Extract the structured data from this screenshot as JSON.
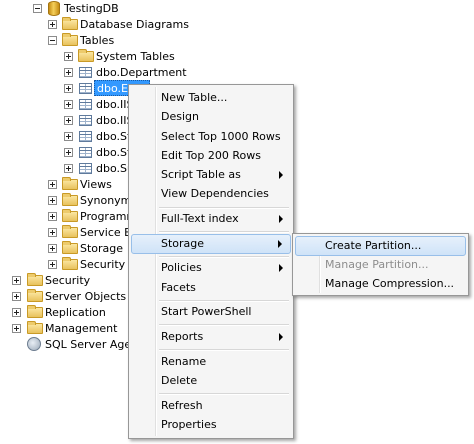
{
  "tree": {
    "database": "TestingDB",
    "database_diagrams": "Database Diagrams",
    "tables": "Tables",
    "system_tables": "System Tables",
    "dbo_department": "dbo.Department",
    "dbo_employee": "dbo.Em",
    "dbo_iis1": "dbo.IIS",
    "dbo_iis2": "dbo.IIS",
    "dbo_st1": "dbo.St",
    "dbo_st2": "dbo.St",
    "dbo_su": "dbo.Su",
    "views": "Views",
    "synonyms": "Synonyms",
    "programmability": "Programm",
    "service_broker": "Service Bro",
    "storage": "Storage",
    "security_inner": "Security",
    "security": "Security",
    "server_objects": "Server Objects",
    "replication": "Replication",
    "management": "Management",
    "sql_agent": "SQL Server Agent"
  },
  "context_menu": {
    "new_table": "New Table...",
    "design": "Design",
    "select_top": "Select Top 1000 Rows",
    "edit_top": "Edit Top 200 Rows",
    "script_table_as": "Script Table as",
    "view_dependencies": "View Dependencies",
    "full_text_index": "Full-Text index",
    "storage": "Storage",
    "policies": "Policies",
    "facets": "Facets",
    "start_powershell": "Start PowerShell",
    "reports": "Reports",
    "rename": "Rename",
    "delete": "Delete",
    "refresh": "Refresh",
    "properties": "Properties"
  },
  "storage_submenu": {
    "create_partition": "Create Partition...",
    "manage_partition": "Manage Partition...",
    "manage_compression": "Manage Compression..."
  }
}
